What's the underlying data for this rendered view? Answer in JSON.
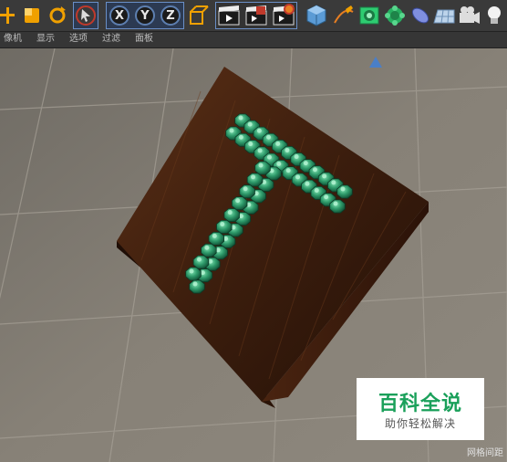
{
  "toolbar": {
    "axis_x": "X",
    "axis_y": "Y",
    "axis_z": "Z"
  },
  "menu": [
    "像机",
    "显示",
    "选项",
    "过滤",
    "面板"
  ],
  "watermark": {
    "title": "百科全说",
    "subtitle": "助你轻松解决"
  },
  "viewport": {
    "status_label": "网格间距"
  },
  "colors": {
    "toolbar_bg": "#3a3a3a",
    "menu_bg": "#363636",
    "floor": "#7f7a72",
    "wood": "#3a1c0d",
    "gem": "#2e9a6a",
    "watermark_green": "#1aa05a"
  }
}
